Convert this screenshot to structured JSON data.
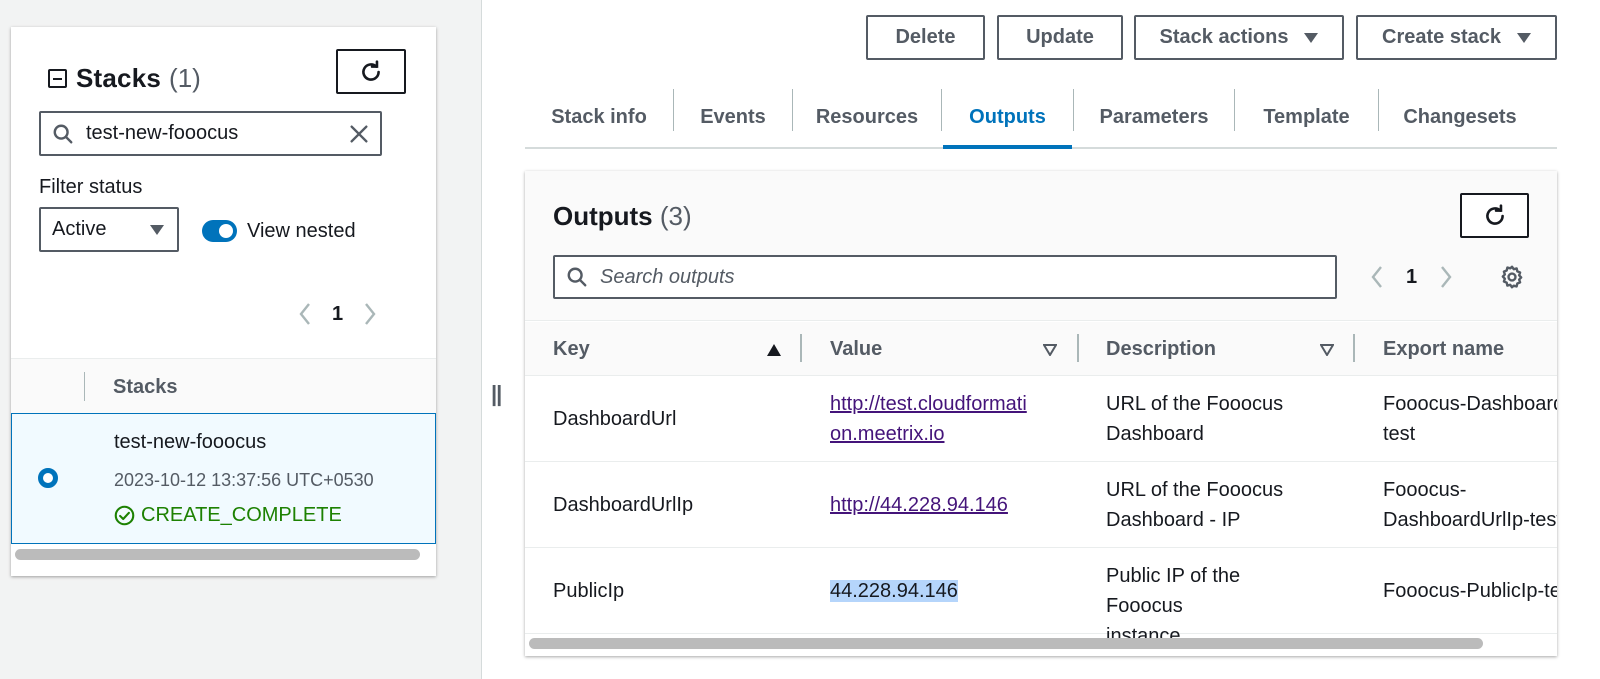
{
  "stacks_panel": {
    "title": "Stacks",
    "count": "(1)",
    "search_value": "test-new-fooocus",
    "filter_label": "Filter status",
    "filter_value": "Active",
    "toggle_label": "View nested",
    "page": "1",
    "column_header": "Stacks",
    "stack": {
      "name": "test-new-fooocus",
      "timestamp": "2023-10-12 13:37:56 UTC+0530",
      "status": "CREATE_COMPLETE"
    }
  },
  "actions": {
    "delete": "Delete",
    "update": "Update",
    "stack_actions": "Stack actions",
    "create_stack": "Create stack"
  },
  "tabs": [
    {
      "label": "Stack info",
      "active": false
    },
    {
      "label": "Events",
      "active": false
    },
    {
      "label": "Resources",
      "active": false
    },
    {
      "label": "Outputs",
      "active": true
    },
    {
      "label": "Parameters",
      "active": false
    },
    {
      "label": "Template",
      "active": false
    },
    {
      "label": "Changesets",
      "active": false
    }
  ],
  "outputs": {
    "title": "Outputs",
    "count": "(3)",
    "search_placeholder": "Search outputs",
    "page": "1",
    "columns": {
      "key": "Key",
      "value": "Value",
      "description": "Description",
      "export_name": "Export name"
    },
    "rows": [
      {
        "key": "DashboardUrl",
        "value": [
          "http://test.cloudformati",
          "on.meetrix.io"
        ],
        "description": [
          "URL of the Fooocus",
          "Dashboard"
        ],
        "export_name": [
          "Fooocus-DashboardUrl-",
          "test"
        ]
      },
      {
        "key": "DashboardUrlIp",
        "value": [
          "http://44.228.94.146"
        ],
        "description": [
          "URL of the Fooocus",
          "Dashboard - IP"
        ],
        "export_name": [
          "Fooocus-",
          "DashboardUrlIp-test"
        ]
      },
      {
        "key": "PublicIp",
        "value": [
          "44.228.94.146"
        ],
        "description": [
          "Public IP of the Fooocus",
          "instance"
        ],
        "export_name": [
          "Fooocus-PublicIp-test"
        ]
      }
    ]
  },
  "colors": {
    "accent": "#0073bb",
    "success": "#1d8102",
    "link": "#44147a",
    "selection": "#b5d5fb"
  }
}
